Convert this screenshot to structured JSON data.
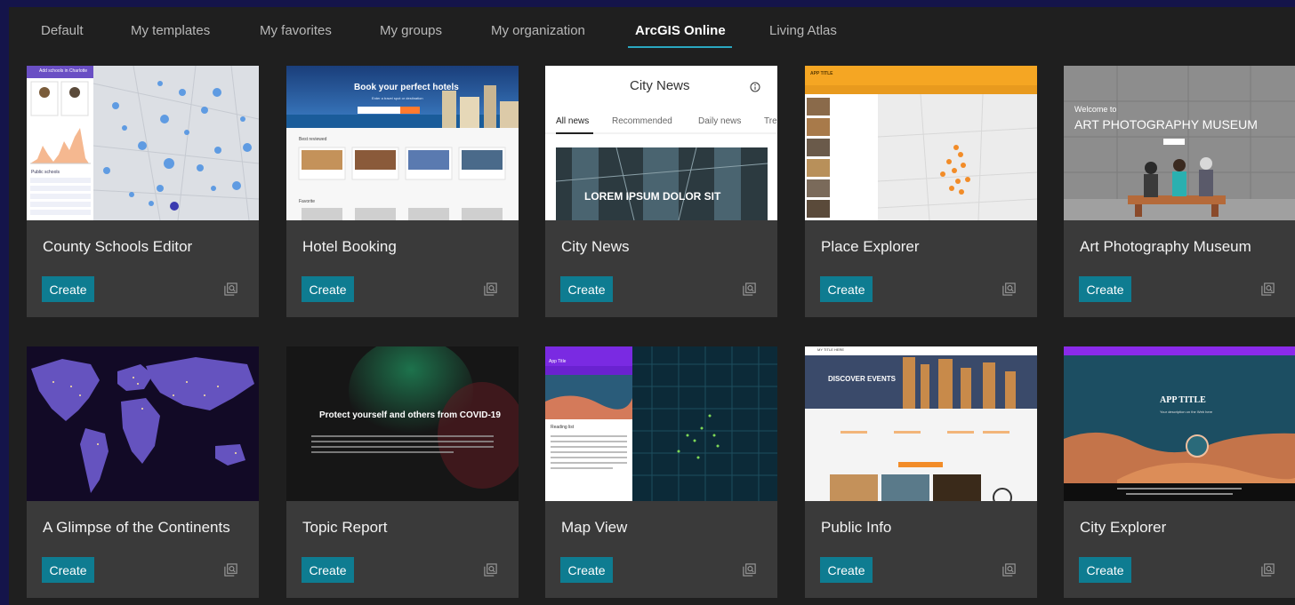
{
  "tabs": [
    {
      "label": "Default"
    },
    {
      "label": "My templates"
    },
    {
      "label": "My favorites"
    },
    {
      "label": "My groups"
    },
    {
      "label": "My organization"
    },
    {
      "label": "ArcGIS Online",
      "active": true
    },
    {
      "label": "Living Atlas"
    }
  ],
  "cards": [
    {
      "title": "County Schools Editor",
      "button": "Create",
      "thumb": {
        "header": "Add schools in Charlotte",
        "sub": "Public schools"
      }
    },
    {
      "title": "Hotel Booking",
      "button": "Create",
      "thumb": {
        "banner": "Book your perfect hotels",
        "sub": "Enter a travel spot or destination",
        "section1": "Best reviewed",
        "section2": "Favorite"
      }
    },
    {
      "title": "City News",
      "button": "Create",
      "thumb": {
        "heading": "City News",
        "tabs": [
          "All news",
          "Recommended",
          "Daily news",
          "Tre"
        ],
        "overlay": "LOREM IPSUM DOLOR SIT"
      }
    },
    {
      "title": "Place Explorer",
      "button": "Create",
      "thumb": {
        "header": "APP TITLE"
      }
    },
    {
      "title": "Art Photography Museum",
      "button": "Create",
      "thumb": {
        "welcome": "Welcome to",
        "heading": "ART PHOTOGRAPHY MUSEUM"
      }
    },
    {
      "title": "A Glimpse of the Continents",
      "button": "Create",
      "thumb": {}
    },
    {
      "title": "Topic Report",
      "button": "Create",
      "thumb": {
        "heading": "Protect yourself and others from COVID-19"
      }
    },
    {
      "title": "Map View",
      "button": "Create",
      "thumb": {
        "header": "App Title",
        "section": "Reading list"
      }
    },
    {
      "title": "Public Info",
      "button": "Create",
      "thumb": {
        "header": "MY TITLE HERE",
        "banner": "DISCOVER EVENTS"
      }
    },
    {
      "title": "City Explorer",
      "button": "Create",
      "thumb": {
        "heading": "APP TITLE",
        "sub": "Your description on the Web here"
      }
    }
  ]
}
